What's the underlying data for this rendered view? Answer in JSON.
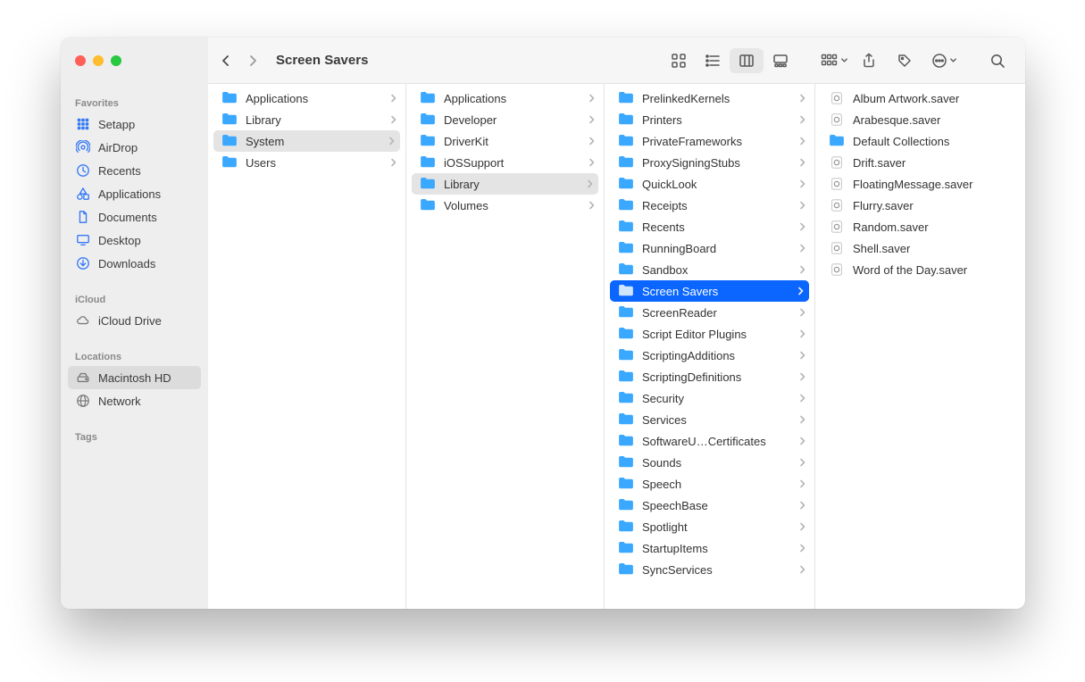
{
  "window": {
    "title": "Screen Savers"
  },
  "sidebar": {
    "sections": [
      {
        "title": "Favorites",
        "items": [
          {
            "icon": "apps-grid",
            "label": "Setapp",
            "color": "blue"
          },
          {
            "icon": "airdrop",
            "label": "AirDrop",
            "color": "blue"
          },
          {
            "icon": "clock",
            "label": "Recents",
            "color": "blue"
          },
          {
            "icon": "apps",
            "label": "Applications",
            "color": "blue"
          },
          {
            "icon": "document",
            "label": "Documents",
            "color": "blue"
          },
          {
            "icon": "desktop",
            "label": "Desktop",
            "color": "blue"
          },
          {
            "icon": "download",
            "label": "Downloads",
            "color": "blue"
          }
        ]
      },
      {
        "title": "iCloud",
        "items": [
          {
            "icon": "cloud",
            "label": "iCloud Drive",
            "color": "gray"
          }
        ]
      },
      {
        "title": "Locations",
        "items": [
          {
            "icon": "disk",
            "label": "Macintosh HD",
            "color": "gray",
            "selected": true
          },
          {
            "icon": "globe",
            "label": "Network",
            "color": "gray"
          }
        ]
      },
      {
        "title": "Tags",
        "items": []
      }
    ]
  },
  "columns": [
    {
      "items": [
        {
          "type": "folder",
          "label": "Applications",
          "hasChildren": true
        },
        {
          "type": "folder",
          "label": "Library",
          "hasChildren": true
        },
        {
          "type": "folder",
          "label": "System",
          "hasChildren": true,
          "selected": "gray"
        },
        {
          "type": "folder",
          "label": "Users",
          "hasChildren": true
        }
      ]
    },
    {
      "items": [
        {
          "type": "folder",
          "label": "Applications",
          "hasChildren": true
        },
        {
          "type": "folder",
          "label": "Developer",
          "hasChildren": true
        },
        {
          "type": "folder",
          "label": "DriverKit",
          "hasChildren": true
        },
        {
          "type": "folder",
          "label": "iOSSupport",
          "hasChildren": true
        },
        {
          "type": "folder",
          "label": "Library",
          "hasChildren": true,
          "selected": "gray"
        },
        {
          "type": "folder",
          "label": "Volumes",
          "hasChildren": true
        }
      ]
    },
    {
      "items": [
        {
          "type": "folder",
          "label": "PrelinkedKernels",
          "hasChildren": true
        },
        {
          "type": "folder",
          "label": "Printers",
          "hasChildren": true
        },
        {
          "type": "folder",
          "label": "PrivateFrameworks",
          "hasChildren": true
        },
        {
          "type": "folder",
          "label": "ProxySigningStubs",
          "hasChildren": true
        },
        {
          "type": "folder",
          "label": "QuickLook",
          "hasChildren": true
        },
        {
          "type": "folder",
          "label": "Receipts",
          "hasChildren": true
        },
        {
          "type": "folder",
          "label": "Recents",
          "hasChildren": true
        },
        {
          "type": "folder",
          "label": "RunningBoard",
          "hasChildren": true
        },
        {
          "type": "folder",
          "label": "Sandbox",
          "hasChildren": true
        },
        {
          "type": "folder",
          "label": "Screen Savers",
          "hasChildren": true,
          "selected": "blue"
        },
        {
          "type": "folder",
          "label": "ScreenReader",
          "hasChildren": true
        },
        {
          "type": "folder",
          "label": "Script Editor Plugins",
          "hasChildren": true
        },
        {
          "type": "folder",
          "label": "ScriptingAdditions",
          "hasChildren": true
        },
        {
          "type": "folder",
          "label": "ScriptingDefinitions",
          "hasChildren": true
        },
        {
          "type": "folder",
          "label": "Security",
          "hasChildren": true
        },
        {
          "type": "folder",
          "label": "Services",
          "hasChildren": true
        },
        {
          "type": "folder",
          "label": "SoftwareU…Certificates",
          "hasChildren": true
        },
        {
          "type": "folder",
          "label": "Sounds",
          "hasChildren": true
        },
        {
          "type": "folder",
          "label": "Speech",
          "hasChildren": true
        },
        {
          "type": "folder",
          "label": "SpeechBase",
          "hasChildren": true
        },
        {
          "type": "folder",
          "label": "Spotlight",
          "hasChildren": true
        },
        {
          "type": "folder",
          "label": "StartupItems",
          "hasChildren": true
        },
        {
          "type": "folder",
          "label": "SyncServices",
          "hasChildren": true
        }
      ]
    },
    {
      "items": [
        {
          "type": "file",
          "label": "Album Artwork.saver"
        },
        {
          "type": "file",
          "label": "Arabesque.saver"
        },
        {
          "type": "folder",
          "label": "Default Collections"
        },
        {
          "type": "file",
          "label": "Drift.saver"
        },
        {
          "type": "file",
          "label": "FloatingMessage.saver"
        },
        {
          "type": "file",
          "label": "Flurry.saver"
        },
        {
          "type": "file",
          "label": "Random.saver"
        },
        {
          "type": "file",
          "label": "Shell.saver"
        },
        {
          "type": "file",
          "label": "Word of the Day.saver"
        }
      ]
    }
  ]
}
